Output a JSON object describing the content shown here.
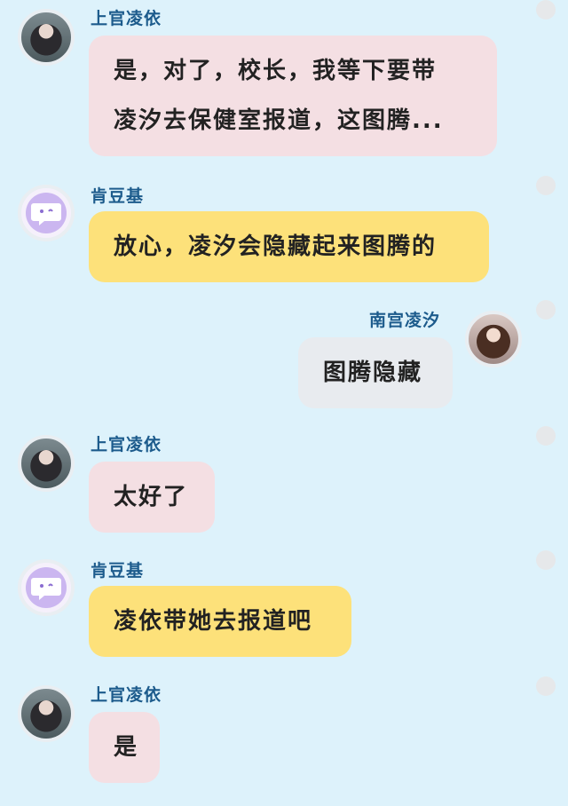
{
  "messages": [
    {
      "sender": "上官凌依",
      "lines": [
        "是，对了，校长，我等下要带",
        "凌汐去保健室报道，这图腾..."
      ],
      "avatar_icon": "girl-portrait-avatar",
      "bubble_color": "#f4dfe3"
    },
    {
      "sender": "肯豆基",
      "lines": [
        "放心，凌汐会隐藏起来图腾的"
      ],
      "avatar_icon": "purple-bot-avatar",
      "bubble_color": "#fde17a"
    },
    {
      "sender": "南宫凌汐",
      "lines": [
        "图腾隐藏"
      ],
      "avatar_icon": "girl-portrait-avatar",
      "bubble_color": "#e8ebef"
    },
    {
      "sender": "上官凌依",
      "lines": [
        "太好了"
      ],
      "avatar_icon": "girl-portrait-avatar",
      "bubble_color": "#f4dfe3"
    },
    {
      "sender": "肯豆基",
      "lines": [
        "凌依带她去报道吧"
      ],
      "avatar_icon": "purple-bot-avatar",
      "bubble_color": "#fde17a"
    },
    {
      "sender": "上官凌依",
      "lines": [
        "是"
      ],
      "avatar_icon": "girl-portrait-avatar",
      "bubble_color": "#f4dfe3"
    }
  ]
}
